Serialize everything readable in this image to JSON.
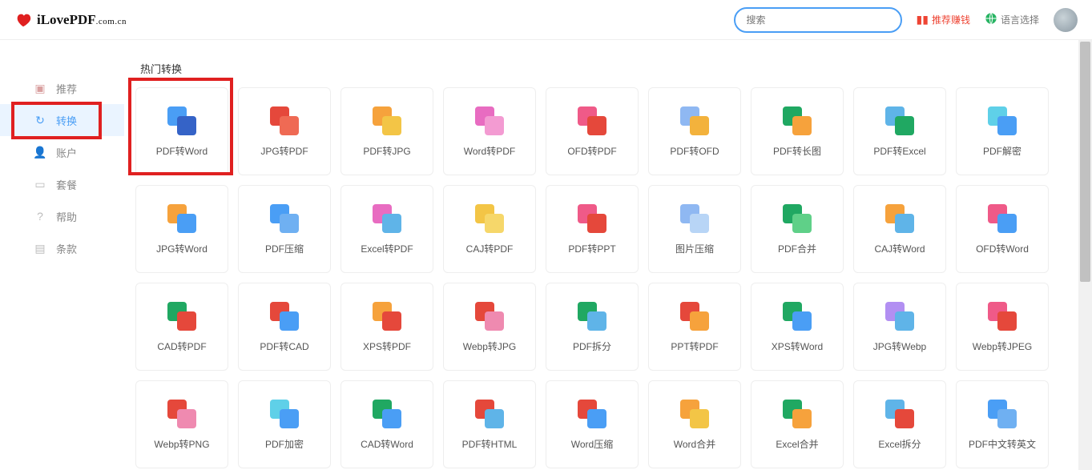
{
  "header": {
    "logo_main": "iLovePDF",
    "logo_domain": ".com.cn",
    "search_placeholder": "搜索",
    "recommend_label": "推荐赚钱",
    "language_label": "语言选择"
  },
  "sidebar": {
    "items": [
      {
        "label": "推荐",
        "icon": "gift-icon"
      },
      {
        "label": "转换",
        "icon": "refresh-icon"
      },
      {
        "label": "账户",
        "icon": "user-icon"
      },
      {
        "label": "套餐",
        "icon": "card-icon"
      },
      {
        "label": "帮助",
        "icon": "help-icon"
      },
      {
        "label": "条款",
        "icon": "doc-icon"
      }
    ],
    "active_index": 1
  },
  "section_title": "热门转换",
  "tiles": [
    {
      "label": "PDF转Word",
      "c1": "#4a9ef5",
      "c2": "#3563c7"
    },
    {
      "label": "JPG转PDF",
      "c1": "#e5483b",
      "c2": "#ef6a54"
    },
    {
      "label": "PDF转JPG",
      "c1": "#f6a23c",
      "c2": "#f3c546"
    },
    {
      "label": "Word转PDF",
      "c1": "#e86cc1",
      "c2": "#f39bd2"
    },
    {
      "label": "OFD转PDF",
      "c1": "#ef5a88",
      "c2": "#e5483b"
    },
    {
      "label": "PDF转OFD",
      "c1": "#8fb8f2",
      "c2": "#f3b23c"
    },
    {
      "label": "PDF转长图",
      "c1": "#20a862",
      "c2": "#f6a23c"
    },
    {
      "label": "PDF转Excel",
      "c1": "#5fb4e8",
      "c2": "#20a862"
    },
    {
      "label": "PDF解密",
      "c1": "#5fd0e8",
      "c2": "#4a9ef5"
    },
    {
      "label": "JPG转Word",
      "c1": "#f6a23c",
      "c2": "#4a9ef5"
    },
    {
      "label": "PDF压缩",
      "c1": "#4a9ef5",
      "c2": "#6fb0f2"
    },
    {
      "label": "Excel转PDF",
      "c1": "#e86cc1",
      "c2": "#5fb4e8"
    },
    {
      "label": "CAJ转PDF",
      "c1": "#f3c546",
      "c2": "#f6d76a"
    },
    {
      "label": "PDF转PPT",
      "c1": "#ef5a88",
      "c2": "#e5483b"
    },
    {
      "label": "图片压缩",
      "c1": "#8fb8f2",
      "c2": "#b8d5f6"
    },
    {
      "label": "PDF合并",
      "c1": "#20a862",
      "c2": "#5fd088"
    },
    {
      "label": "CAJ转Word",
      "c1": "#f6a23c",
      "c2": "#5fb4e8"
    },
    {
      "label": "OFD转Word",
      "c1": "#ef5a88",
      "c2": "#4a9ef5"
    },
    {
      "label": "CAD转PDF",
      "c1": "#20a862",
      "c2": "#e5483b"
    },
    {
      "label": "PDF转CAD",
      "c1": "#e5483b",
      "c2": "#4a9ef5"
    },
    {
      "label": "XPS转PDF",
      "c1": "#f6a23c",
      "c2": "#e5483b"
    },
    {
      "label": "Webp转JPG",
      "c1": "#e5483b",
      "c2": "#ef8ab0"
    },
    {
      "label": "PDF拆分",
      "c1": "#20a862",
      "c2": "#5fb4e8"
    },
    {
      "label": "PPT转PDF",
      "c1": "#e5483b",
      "c2": "#f6a23c"
    },
    {
      "label": "XPS转Word",
      "c1": "#20a862",
      "c2": "#4a9ef5"
    },
    {
      "label": "JPG转Webp",
      "c1": "#b28ff2",
      "c2": "#5fb4e8"
    },
    {
      "label": "Webp转JPEG",
      "c1": "#ef5a88",
      "c2": "#e5483b"
    },
    {
      "label": "Webp转PNG",
      "c1": "#e5483b",
      "c2": "#ef8ab0"
    },
    {
      "label": "PDF加密",
      "c1": "#5fd0e8",
      "c2": "#4a9ef5"
    },
    {
      "label": "CAD转Word",
      "c1": "#20a862",
      "c2": "#4a9ef5"
    },
    {
      "label": "PDF转HTML",
      "c1": "#e5483b",
      "c2": "#5fb4e8"
    },
    {
      "label": "Word压缩",
      "c1": "#e5483b",
      "c2": "#4a9ef5"
    },
    {
      "label": "Word合并",
      "c1": "#f6a23c",
      "c2": "#f3c546"
    },
    {
      "label": "Excel合并",
      "c1": "#20a862",
      "c2": "#f6a23c"
    },
    {
      "label": "Excel拆分",
      "c1": "#5fb4e8",
      "c2": "#e5483b"
    },
    {
      "label": "PDF中文转英文",
      "c1": "#4a9ef5",
      "c2": "#6fb0f2"
    }
  ],
  "highlights": {
    "sidebar_item_index": 1,
    "tile_index": 0
  }
}
